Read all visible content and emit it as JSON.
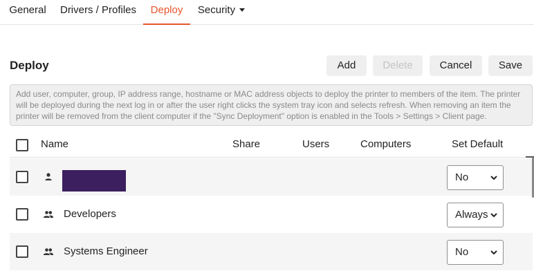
{
  "tabs": {
    "general": "General",
    "drivers": "Drivers / Profiles",
    "deploy": "Deploy",
    "security": "Security"
  },
  "page": {
    "title": "Deploy"
  },
  "actions": {
    "add": "Add",
    "delete": "Delete",
    "cancel": "Cancel",
    "save": "Save"
  },
  "info_text": "Add user, computer, group, IP address range, hostname or MAC address objects to deploy the printer to members of the item. The printer will be deployed during the next log in or after the user right clicks the system tray icon and selects refresh. When removing an item the printer will be removed from the client computer if the \"Sync Deployment\" option is enabled in the Tools > Settings > Client page.",
  "table": {
    "headers": {
      "name": "Name",
      "share": "Share",
      "users": "Users",
      "computers": "Computers",
      "set_default": "Set Default"
    },
    "rows": [
      {
        "type": "user-icon",
        "name": "",
        "set_default": "No"
      },
      {
        "type": "group-icon",
        "name": "Developers",
        "set_default": "Always"
      },
      {
        "type": "group-icon",
        "name": "Systems Engineer",
        "set_default": "No"
      }
    ]
  },
  "colors": {
    "accent": "#e8542a",
    "redaction": "#3b1f5f"
  }
}
